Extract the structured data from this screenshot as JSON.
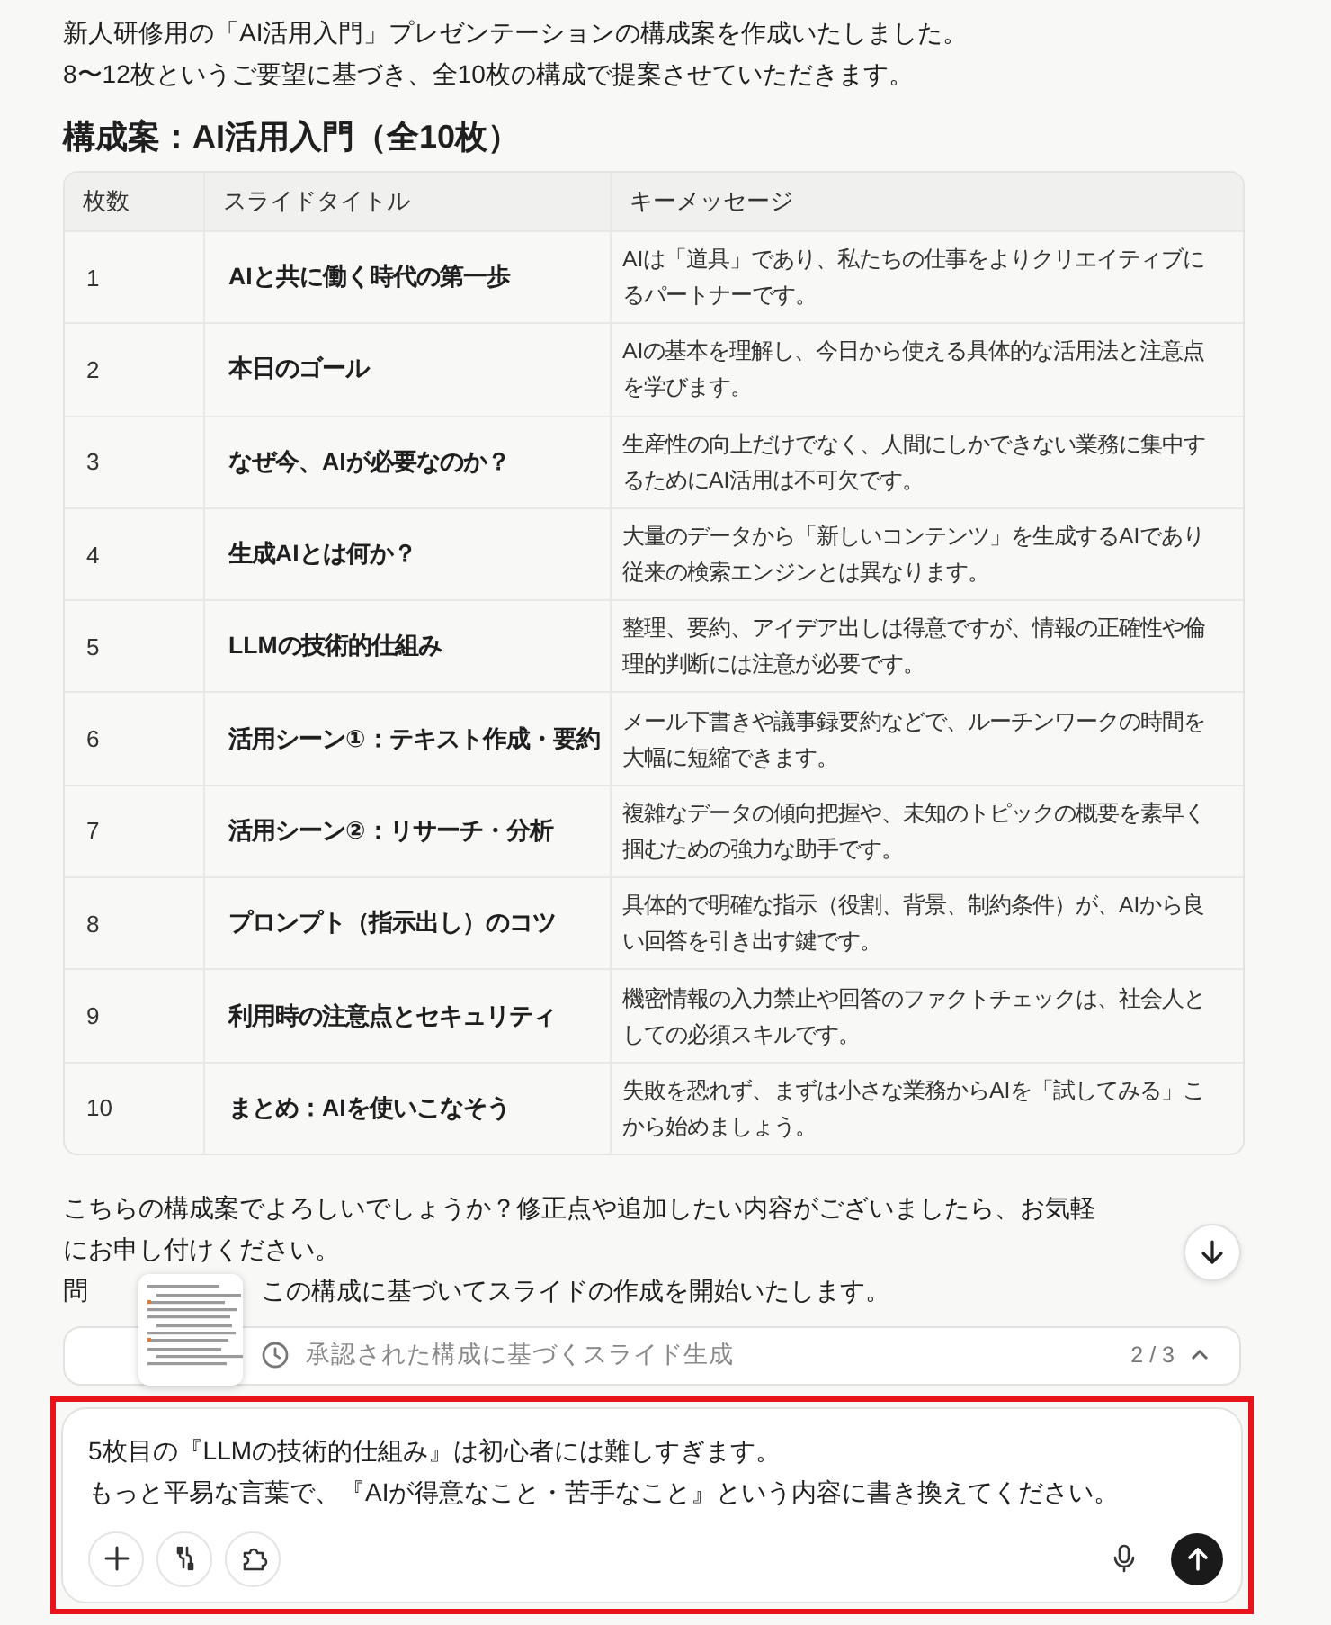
{
  "message": {
    "paragraphs": [
      "新人研修用の「AI活用入門」プレゼンテーションの構成案を作成いたしました。",
      "8〜12枚というご要望に基づき、全10枚の構成で提案させていただきます。"
    ],
    "heading": "構成案：AI活用入門（全10枚）",
    "table": {
      "columns": [
        "枚数",
        "スライドタイトル",
        "キーメッセージ"
      ],
      "rows": [
        {
          "number": "1",
          "title": "AIと共に働く時代の第一歩",
          "message": [
            "AIは「道具」であり、私たちの仕事をよりクリエイティブに",
            "るパートナーです。"
          ]
        },
        {
          "number": "2",
          "title": "本日のゴール",
          "message": [
            "AIの基本を理解し、今日から使える具体的な活用法と注意点",
            "を学びます。"
          ]
        },
        {
          "number": "3",
          "title": "なぜ今、AIが必要なのか？",
          "message": [
            "生産性の向上だけでなく、人間にしかできない業務に集中す",
            "るためにAI活用は不可欠です。"
          ]
        },
        {
          "number": "4",
          "title": "生成AIとは何か？",
          "message": [
            "大量のデータから「新しいコンテンツ」を生成するAIであり",
            "従来の検索エンジンとは異なります。"
          ]
        },
        {
          "number": "5",
          "title": "LLMの技術的仕組み",
          "message": [
            "整理、要約、アイデア出しは得意ですが、情報の正確性や倫",
            "理的判断には注意が必要です。"
          ]
        },
        {
          "number": "6",
          "title": "活用シーン①：テキスト作成・要約",
          "message": [
            "メール下書きや議事録要約などで、ルーチンワークの時間を",
            "大幅に短縮できます。"
          ]
        },
        {
          "number": "7",
          "title": "活用シーン②：リサーチ・分析",
          "message": [
            "複雑なデータの傾向把握や、未知のトピックの概要を素早く",
            "掴むための強力な助手です。"
          ]
        },
        {
          "number": "8",
          "title": "プロンプト（指示出し）のコツ",
          "message": [
            "具体的で明確な指示（役割、背景、制約条件）が、AIから良",
            "い回答を引き出す鍵です。"
          ]
        },
        {
          "number": "9",
          "title": "利用時の注意点とセキュリティ",
          "message": [
            "機密情報の入力禁止や回答のファクトチェックは、社会人と",
            "しての必須スキルです。"
          ]
        },
        {
          "number": "10",
          "title": "まとめ：AIを使いこなそう",
          "message": [
            "失敗を恐れず、まずは小さな業務からAIを「試してみる」こ",
            "から始めましょう。"
          ]
        }
      ]
    },
    "closing": [
      "こちらの構成案でよろしいでしょうか？修正点や追加したい内容がございましたら、お気軽にお申し付けください。"
    ],
    "closing_last": [
      "問",
      "この構成に基づいてスライドの作成を開始いたします。"
    ]
  },
  "task": {
    "label": "承認された構成に基づくスライド生成",
    "progress": "2 / 3",
    "expanded": false
  },
  "composer": {
    "value_lines": [
      "5枚目の『LLMの技術的仕組み』は初心者には難しすぎます。",
      "もっと平易な言葉で、『AIが得意なこと・苦手なこと』という内容に書き換えてください。"
    ],
    "highlighted": true
  }
}
